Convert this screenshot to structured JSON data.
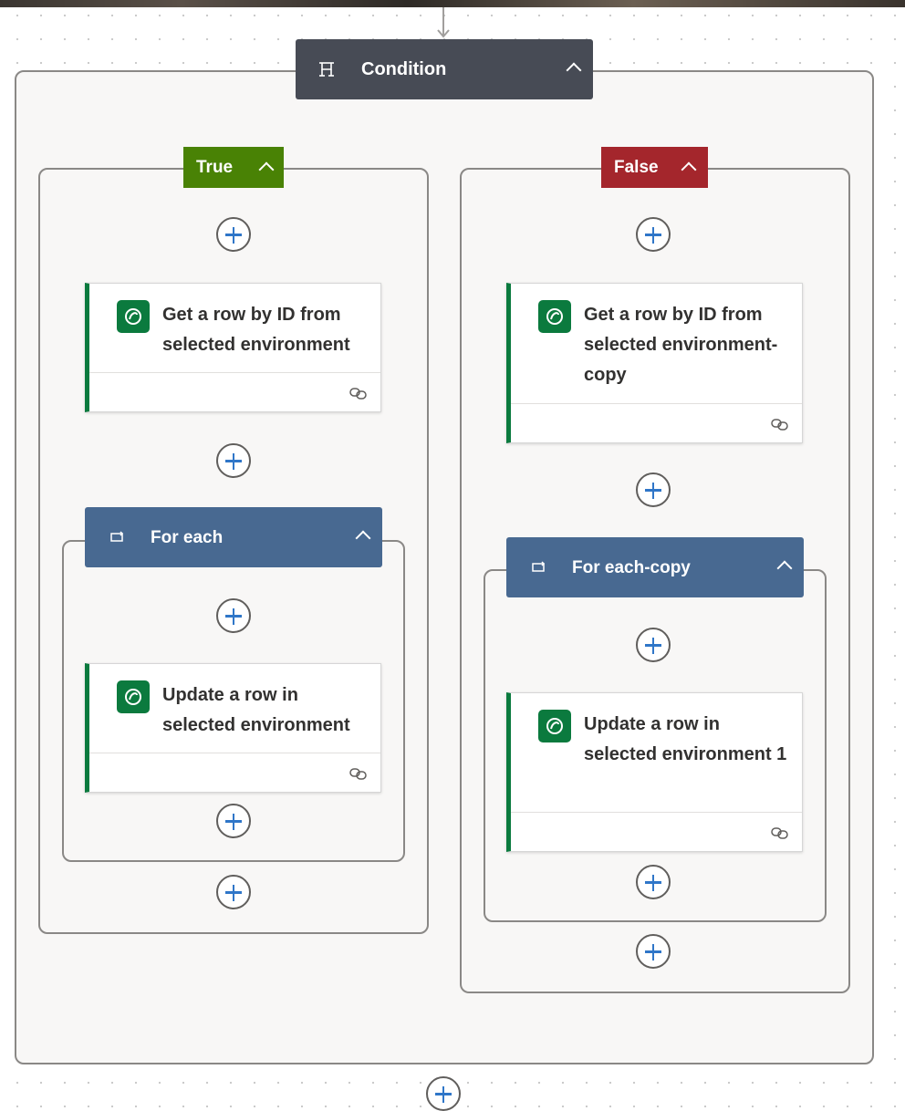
{
  "condition": {
    "label": "Condition",
    "icon": "condition-icon"
  },
  "true_branch": {
    "label": "True",
    "color": "#498205",
    "get_row": {
      "title": "Get a row by ID from selected environment"
    },
    "for_each": {
      "label": "For each"
    },
    "update_row": {
      "title": "Update a row in selected environment"
    }
  },
  "false_branch": {
    "label": "False",
    "color": "#a4262c",
    "get_row": {
      "title": "Get a row by ID from selected environment-copy"
    },
    "for_each": {
      "label": "For each-copy"
    },
    "update_row": {
      "title": "Update a row in selected environment 1"
    }
  },
  "colors": {
    "condition_header": "#474b55",
    "loop_header": "#486991",
    "dataverse_green": "#0b7a3e",
    "add_plus": "#2f76c8"
  },
  "icons": {
    "dataverse": "dataverse-icon",
    "loop": "loop-icon",
    "link": "link-icon",
    "collapse": "chevron-up-icon",
    "add": "plus-icon"
  }
}
